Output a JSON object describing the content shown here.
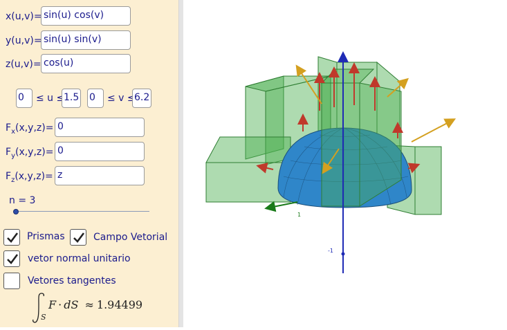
{
  "inputs": {
    "x_label": "x(u,v)=",
    "x_value": "sin(u) cos(v)",
    "y_label": "y(u,v)=",
    "y_value": "sin(u) sin(v)",
    "z_label": "z(u,v)=",
    "z_value": "cos(u)"
  },
  "ranges": {
    "u_min": "0",
    "u_rel": "≤ u ≤",
    "u_max": "1.5",
    "v_min": "0",
    "v_rel": "≤ v ≤",
    "v_max": "6.2"
  },
  "field": {
    "fx_label_main": "F",
    "fx_sub": "x",
    "fx_args": "(x,y,z)=",
    "fx_value": "0",
    "fy_label_main": "F",
    "fy_sub": "y",
    "fy_args": "(x,y,z)=",
    "fy_value": "0",
    "fz_label_main": "F",
    "fz_sub": "z",
    "fz_args": "(x,y,z)=",
    "fz_value": "z"
  },
  "slider": {
    "label": "n = 3",
    "value_fraction": 0.0
  },
  "checkboxes": {
    "prismas_label": "Prismas",
    "prismas_checked": true,
    "campo_label": "Campo Vetorial",
    "campo_checked": true,
    "normal_label": "vetor normal unitario",
    "normal_checked": true,
    "tangentes_label": "Vetores tangentes",
    "tangentes_checked": false
  },
  "result": {
    "F": "F",
    "dot": "·",
    "dS": "dS",
    "approx": "≈",
    "value": "1.94499",
    "sub": "S"
  },
  "view3d": {
    "axis_label_neg1": "-1",
    "axis_label_1": "1",
    "colors": {
      "surface": "#2f86c9",
      "prism": "#4caf50",
      "field_arrow": "#c0392b",
      "normal_arrow": "#d4a020",
      "z_axis": "#1f2bb5",
      "x_axis": "#1a7a1a"
    }
  }
}
